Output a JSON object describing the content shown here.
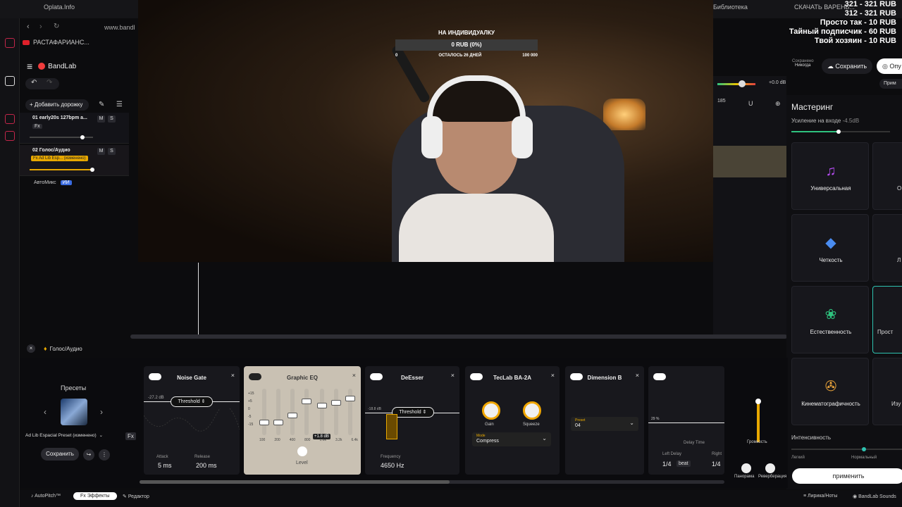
{
  "browser": {
    "tabs": [
      "Oplata.Info",
      "Библиотека",
      "СКАЧАТЬ ВАРЕНЬ..."
    ],
    "url": "www.bandl",
    "bookmark": "РАСТАФАРИАНС..."
  },
  "app": {
    "name": "BandLab",
    "add_track": "Добавить дорожку",
    "tracks": [
      {
        "index": "01",
        "name": "early20s 127bpm a...",
        "fx": "Fx",
        "mute": "M",
        "solo": "S"
      },
      {
        "index": "02",
        "name": "Голос/Аудио",
        "fx": "Fx Ad Lib Esp...",
        "fx_badge": "(изменено)",
        "mute": "M",
        "solo": "S"
      }
    ],
    "automix": "АвтоМикс",
    "automix_badge": "ИИ"
  },
  "stream_goal": {
    "title": "НА ИНДИВИДУАЛКУ",
    "progress_text": "0 RUB (0%)",
    "progress": 0,
    "min": "0",
    "remaining": "ОСТАЛОСЬ 26 ДНЕЙ",
    "max": "100 000"
  },
  "donations": [
    "321 - 321 RUB",
    "312 - 321 RUB",
    "Просто так - 10 RUB",
    "Тайный подписчик - 60 RUB",
    "Твой хозяин - 10 RUB"
  ],
  "save": {
    "saved_label": "Сохранено",
    "saved_when": "Никогда",
    "save_button": "Сохранить",
    "publish_button": "Опу",
    "apply_short": "Прим"
  },
  "timeline": {
    "bar_label": "185",
    "db": "+0.0 dB"
  },
  "mastering": {
    "title": "Мастеринг",
    "input_gain_label": "Усиление на входе",
    "input_gain_value": "-4.5dB",
    "presets": [
      {
        "label": "Универсальная",
        "icon": "music-note-icon",
        "color": "#b44cf0"
      },
      {
        "label": "Четкость",
        "icon": "diamond-icon",
        "color": "#4a8cf0"
      },
      {
        "label": "Естественность",
        "icon": "lotus-icon",
        "color": "#2ec27e"
      },
      {
        "label": "Кинематографичность",
        "icon": "film-reel-icon",
        "color": "#e8a23a"
      }
    ],
    "right_partial": [
      "О",
      "Л",
      "Прост",
      "Изу"
    ],
    "intensity_label": "Интенсивность",
    "intensity_left": "Легкий",
    "intensity_mid": "Нормальный",
    "apply_button": "применить"
  },
  "effects": {
    "track_title": "Голос/Аудио",
    "presets_label": "Пресеты",
    "preset_name": "Ad Lib Espacial Preset (изменено)",
    "save_button": "Сохранить",
    "cards": {
      "noise_gate": {
        "title": "Noise Gate",
        "threshold_value": "-27.2 dB",
        "threshold_label": "Threshold",
        "attack_label": "Attack",
        "attack_value": "5 ms",
        "release_label": "Release",
        "release_value": "200 ms"
      },
      "graphic_eq": {
        "title": "Graphic EQ",
        "scale": [
          "+15",
          "+5",
          "0",
          "-5",
          "-15"
        ],
        "bands": [
          "100",
          "200",
          "400",
          "800",
          "1.6k",
          "3.2k",
          "6.4k"
        ],
        "band_value": "+1.8 dB",
        "level_label": "Level"
      },
      "deesser": {
        "title": "DeEsser",
        "threshold_value": "-18.8 dB",
        "threshold_label": "Threshold",
        "frequency_label": "Frequency",
        "frequency_value": "4650 Hz"
      },
      "teclab": {
        "title": "TecLab BA-2A",
        "gain_label": "Gain",
        "squeeze_label": "Squeeze",
        "mode_label": "Mode",
        "mode_value": "Compress"
      },
      "dimension": {
        "title": "Dimension B",
        "preset_label": "Preset",
        "preset_value": "04"
      },
      "delay": {
        "percent": "29 %",
        "delay_time_label": "Delay Time",
        "left_label": "Left Delay",
        "left_value": "1/4",
        "left_unit": "beat",
        "right_label": "Right",
        "right_value": "1/4"
      }
    },
    "volume_label": "Громкость",
    "pan_label": "Панорама",
    "reverb_label": "Реверберация"
  },
  "bottom_bar": {
    "autopitch": "AutoPitch™",
    "effects_tab": "Эффекты",
    "editor_tab": "Редактор",
    "lyrics": "Лирика/Ноты",
    "sounds": "BandLab Sounds"
  }
}
